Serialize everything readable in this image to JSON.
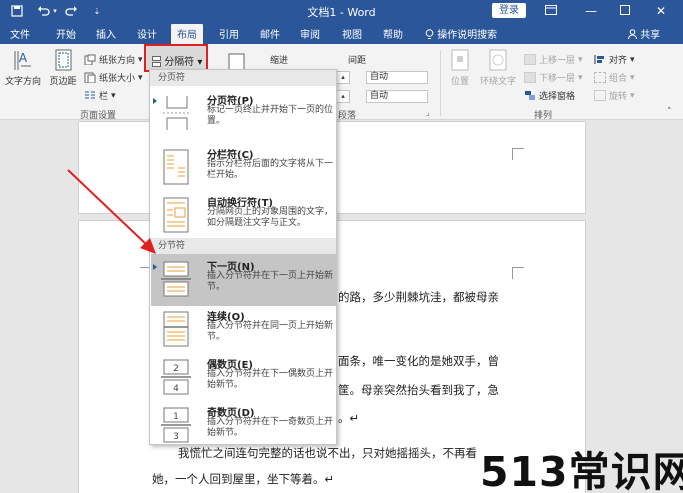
{
  "titlebar": {
    "title": "文档1 - Word",
    "login": "登录",
    "quick_access": [
      "save-icon",
      "undo-icon",
      "redo-icon",
      "customize-icon"
    ],
    "window_controls": [
      "ribbon-display-icon",
      "minimize-icon",
      "maximize-icon",
      "close-icon"
    ]
  },
  "tabs": [
    "文件",
    "开始",
    "插入",
    "设计",
    "布局",
    "引用",
    "邮件",
    "审阅",
    "视图",
    "帮助"
  ],
  "active_tab": "布局",
  "tell_me": "操作说明搜索",
  "share": "共享",
  "ribbon": {
    "text_direction": "文字方向",
    "margins": "页边距",
    "orientation": "纸张方向",
    "size": "纸张大小",
    "columns": "栏",
    "breaks": "分隔符",
    "page_setup_label": "页面设置",
    "indent": "缩进",
    "spacing": "间距",
    "spacing_before": "自动",
    "spacing_after": "自动",
    "paragraph_label": "段落",
    "position": "位置",
    "wrap_text": "环绕文字",
    "bring_forward": "上移一层",
    "send_backward": "下移一层",
    "selection_pane": "选择窗格",
    "align": "对齐",
    "group": "组合",
    "rotate": "旋转",
    "arrange_label": "排列"
  },
  "menu": {
    "section_page_breaks": "分页符",
    "section_section_breaks": "分节符",
    "items": [
      {
        "title": "分页符(P)",
        "desc": "标记一页终止并开始下一页的位置。"
      },
      {
        "title": "分栏符(C)",
        "desc": "指示分栏符后面的文字将从下一栏开始。"
      },
      {
        "title": "自动换行符(T)",
        "desc": "分隔网页上的对象周围的文字，如分隔题注文字与正文。"
      },
      {
        "title": "下一页(N)",
        "desc": "插入分节符并在下一页上开始新节。"
      },
      {
        "title": "连续(O)",
        "desc": "插入分节符并在同一页上开始新节。"
      },
      {
        "title": "偶数页(E)",
        "desc": "插入分节符并在下一偶数页上开始新节。"
      },
      {
        "title": "奇数页(D)",
        "desc": "插入分节符并在下一奇数页上开始新节。"
      }
    ]
  },
  "document": {
    "line1": "的路，多少荆棘坑洼，都被母亲",
    "line2": "面条，唯一变化的是她双手，曾",
    "line3": "筐。母亲突然抬头看到我了，急",
    "line4": "。↵",
    "line5": "我慌忙之间连句完整的话也说不出，只对她摇摇头，不再看",
    "line6": "她，一个人回到屋里，坐下等着。↵"
  },
  "watermark": "513常识网",
  "colors": {
    "accent": "#2b579a",
    "highlight": "#e02020"
  }
}
